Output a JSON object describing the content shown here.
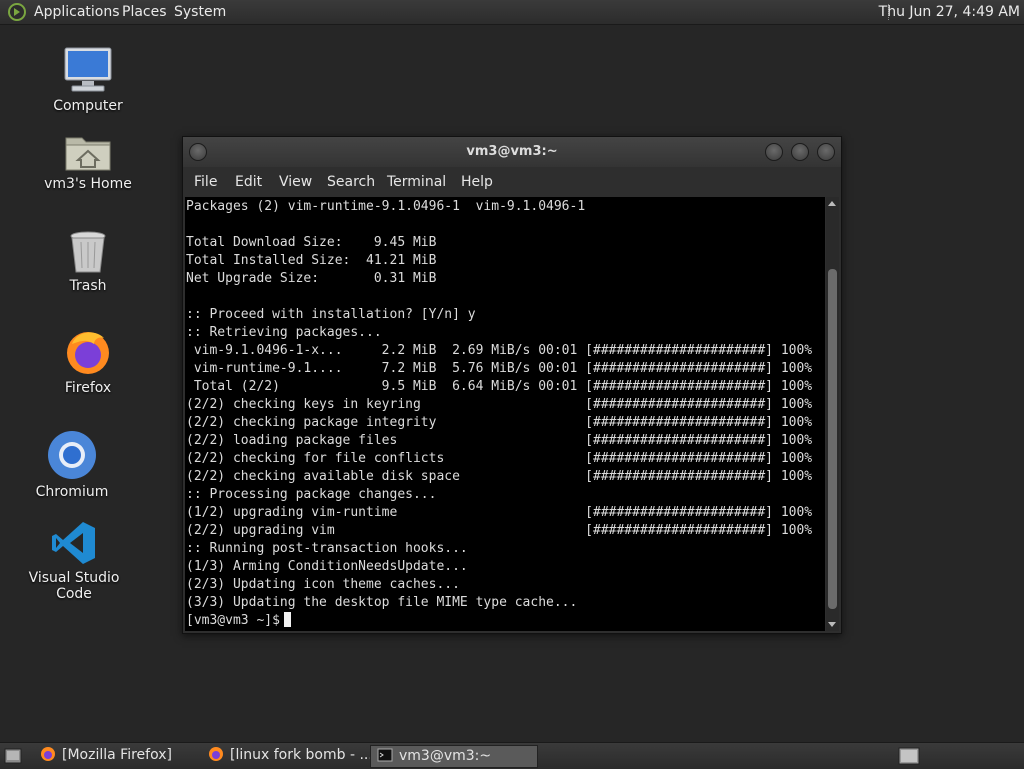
{
  "top_panel": {
    "menus": [
      "Applications",
      "Places",
      "System"
    ],
    "clock": "Thu Jun 27,  4:49 AM"
  },
  "desktop_icons": [
    {
      "label": "Computer",
      "icon": "computer-icon"
    },
    {
      "label": "vm3's Home",
      "icon": "home-folder-icon"
    },
    {
      "label": "Trash",
      "icon": "trash-icon"
    },
    {
      "label": "Firefox",
      "icon": "firefox-icon"
    },
    {
      "label": "Chromium",
      "icon": "chromium-icon"
    },
    {
      "label": "Visual Studio Code",
      "icon": "vscode-icon"
    }
  ],
  "terminal": {
    "title": "vm3@vm3:~",
    "menu": [
      "File",
      "Edit",
      "View",
      "Search",
      "Terminal",
      "Help"
    ],
    "lines": [
      "Packages (2) vim-runtime-9.1.0496-1  vim-9.1.0496-1",
      "",
      "Total Download Size:    9.45 MiB",
      "Total Installed Size:  41.21 MiB",
      "Net Upgrade Size:       0.31 MiB",
      "",
      ":: Proceed with installation? [Y/n] y",
      ":: Retrieving packages...",
      " vim-9.1.0496-1-x...     2.2 MiB  2.69 MiB/s 00:01 [######################] 100%",
      " vim-runtime-9.1....     7.2 MiB  5.76 MiB/s 00:01 [######################] 100%",
      " Total (2/2)             9.5 MiB  6.64 MiB/s 00:01 [######################] 100%",
      "(2/2) checking keys in keyring                     [######################] 100%",
      "(2/2) checking package integrity                   [######################] 100%",
      "(2/2) loading package files                        [######################] 100%",
      "(2/2) checking for file conflicts                  [######################] 100%",
      "(2/2) checking available disk space                [######################] 100%",
      ":: Processing package changes...",
      "(1/2) upgrading vim-runtime                        [######################] 100%",
      "(2/2) upgrading vim                                [######################] 100%",
      ":: Running post-transaction hooks...",
      "(1/3) Arming ConditionNeedsUpdate...",
      "(2/3) Updating icon theme caches...",
      "(3/3) Updating the desktop file MIME type cache..."
    ],
    "prompt": "[vm3@vm3 ~]$"
  },
  "taskbar": {
    "tasks": [
      {
        "label": "[Mozilla Firefox]",
        "icon": "firefox-icon"
      },
      {
        "label": "[linux fork bomb - ...",
        "icon": "firefox-icon"
      },
      {
        "label": "vm3@vm3:~",
        "icon": "terminal-icon"
      }
    ]
  }
}
